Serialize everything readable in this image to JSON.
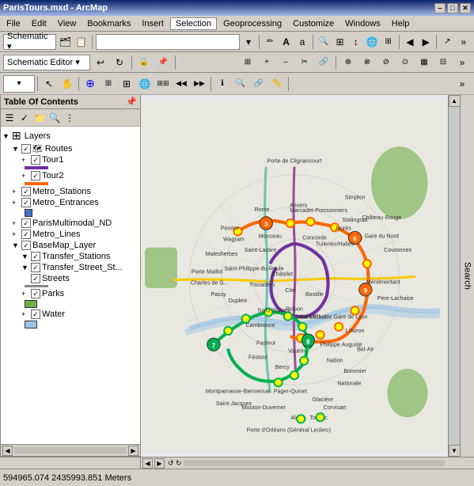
{
  "window": {
    "title": "ParisTours.mxd - ArcMap",
    "minimize": "–",
    "maximize": "□",
    "close": "✕"
  },
  "menu": {
    "items": [
      "File",
      "Edit",
      "View",
      "Bookmarks",
      "Insert",
      "Selection",
      "Geoprocessing",
      "Customize",
      "Windows",
      "Help"
    ]
  },
  "toolbar1": {
    "schematic_label": "Schematic ▾",
    "dropdown_placeholder": ""
  },
  "toolbar2": {
    "schematic_editor_label": "Schematic Editor ▾"
  },
  "toc": {
    "title": "Table Of Contents",
    "layers_label": "Layers",
    "items": [
      {
        "label": "Routes",
        "indent": 1,
        "checked": true,
        "has_expand": true,
        "expanded": true
      },
      {
        "label": "Tour1",
        "indent": 2,
        "checked": true,
        "has_expand": true
      },
      {
        "label": "Tour2",
        "indent": 2,
        "checked": true,
        "has_expand": true
      },
      {
        "label": "Metro_Stations",
        "indent": 1,
        "checked": true,
        "has_expand": true
      },
      {
        "label": "Metro_Entrances",
        "indent": 1,
        "checked": true,
        "has_expand": true
      },
      {
        "label": "ParisMultimodal_ND",
        "indent": 1,
        "checked": true,
        "has_expand": true
      },
      {
        "label": "Metro_Lines",
        "indent": 1,
        "checked": true,
        "has_expand": true
      },
      {
        "label": "BaseMap_Layer",
        "indent": 1,
        "checked": true,
        "has_expand": true,
        "expanded": true
      },
      {
        "label": "Transfer_Stations",
        "indent": 2,
        "checked": true,
        "has_expand": true
      },
      {
        "label": "Transfer_Street_St...",
        "indent": 2,
        "checked": true,
        "has_expand": true
      },
      {
        "label": "Streets",
        "indent": 2,
        "checked": true,
        "has_expand": false
      },
      {
        "label": "Parks",
        "indent": 2,
        "checked": true,
        "has_expand": true
      },
      {
        "label": "Water",
        "indent": 2,
        "checked": true,
        "has_expand": true
      }
    ]
  },
  "status_bar": {
    "coordinates": "594965.074  2435993.851 Meters"
  },
  "search_tab": "Search"
}
